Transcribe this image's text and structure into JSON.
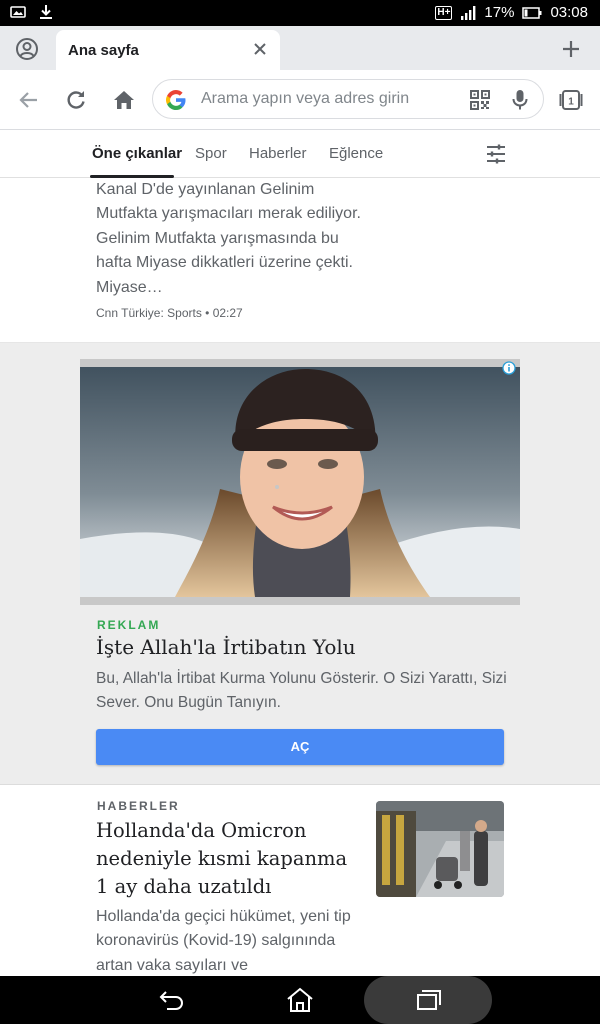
{
  "status_bar": {
    "network": "H+",
    "battery": "17%",
    "time": "03:08",
    "icons": [
      "gallery-icon",
      "download-icon",
      "network-type-icon",
      "signal-icon",
      "battery-icon"
    ]
  },
  "tab_strip": {
    "active_tab_title": "Ana sayfa",
    "icons": [
      "account-icon",
      "close-icon",
      "new-tab-icon"
    ]
  },
  "toolbar": {
    "omnibox_placeholder": "Arama yapın veya adres girin",
    "tab_count": "1",
    "icons": [
      "back-icon",
      "reload-icon",
      "home-icon",
      "google-icon",
      "qr-code-icon",
      "mic-icon",
      "tab-switcher-icon"
    ]
  },
  "feed_tabs": {
    "items": [
      "Öne çıkanlar",
      "Spor",
      "Haberler",
      "Eğlence"
    ],
    "active_index": 0,
    "settings_icon": "tune-icon"
  },
  "article1": {
    "snippet": "Kanal D'de yayınlanan Gelinim Mutfakta yarışmacıları merak ediliyor. Gelinim Mutfakta yarışmasında bu hafta Miyase dikkatleri üzerine çekti. Miyase…",
    "meta": "Cnn Türkiye: Sports • 02:27"
  },
  "ad": {
    "label": "REKLAM",
    "title": "İşte Allah'la İrtibatın Yolu",
    "description": "Bu, Allah'la İrtibat Kurma Yolunu Gösterir. O Sizi Yarattı, Sizi Sever. Onu Bugün Tanıyın.",
    "button_label": "AÇ"
  },
  "article2": {
    "category": "HABERLER",
    "title": "Hollanda'da Omicron nedeniyle kısmi kapanma 1 ay daha uzatıldı",
    "snippet": "Hollanda'da geçici hükümet, yeni tip koronavirüs (Kovid-19) salgınında artan vaka sayıları ve"
  },
  "colors": {
    "accent": "#4a8af4",
    "ad_label": "#34a853",
    "text_primary": "#202124",
    "text_secondary": "#5f6368"
  }
}
